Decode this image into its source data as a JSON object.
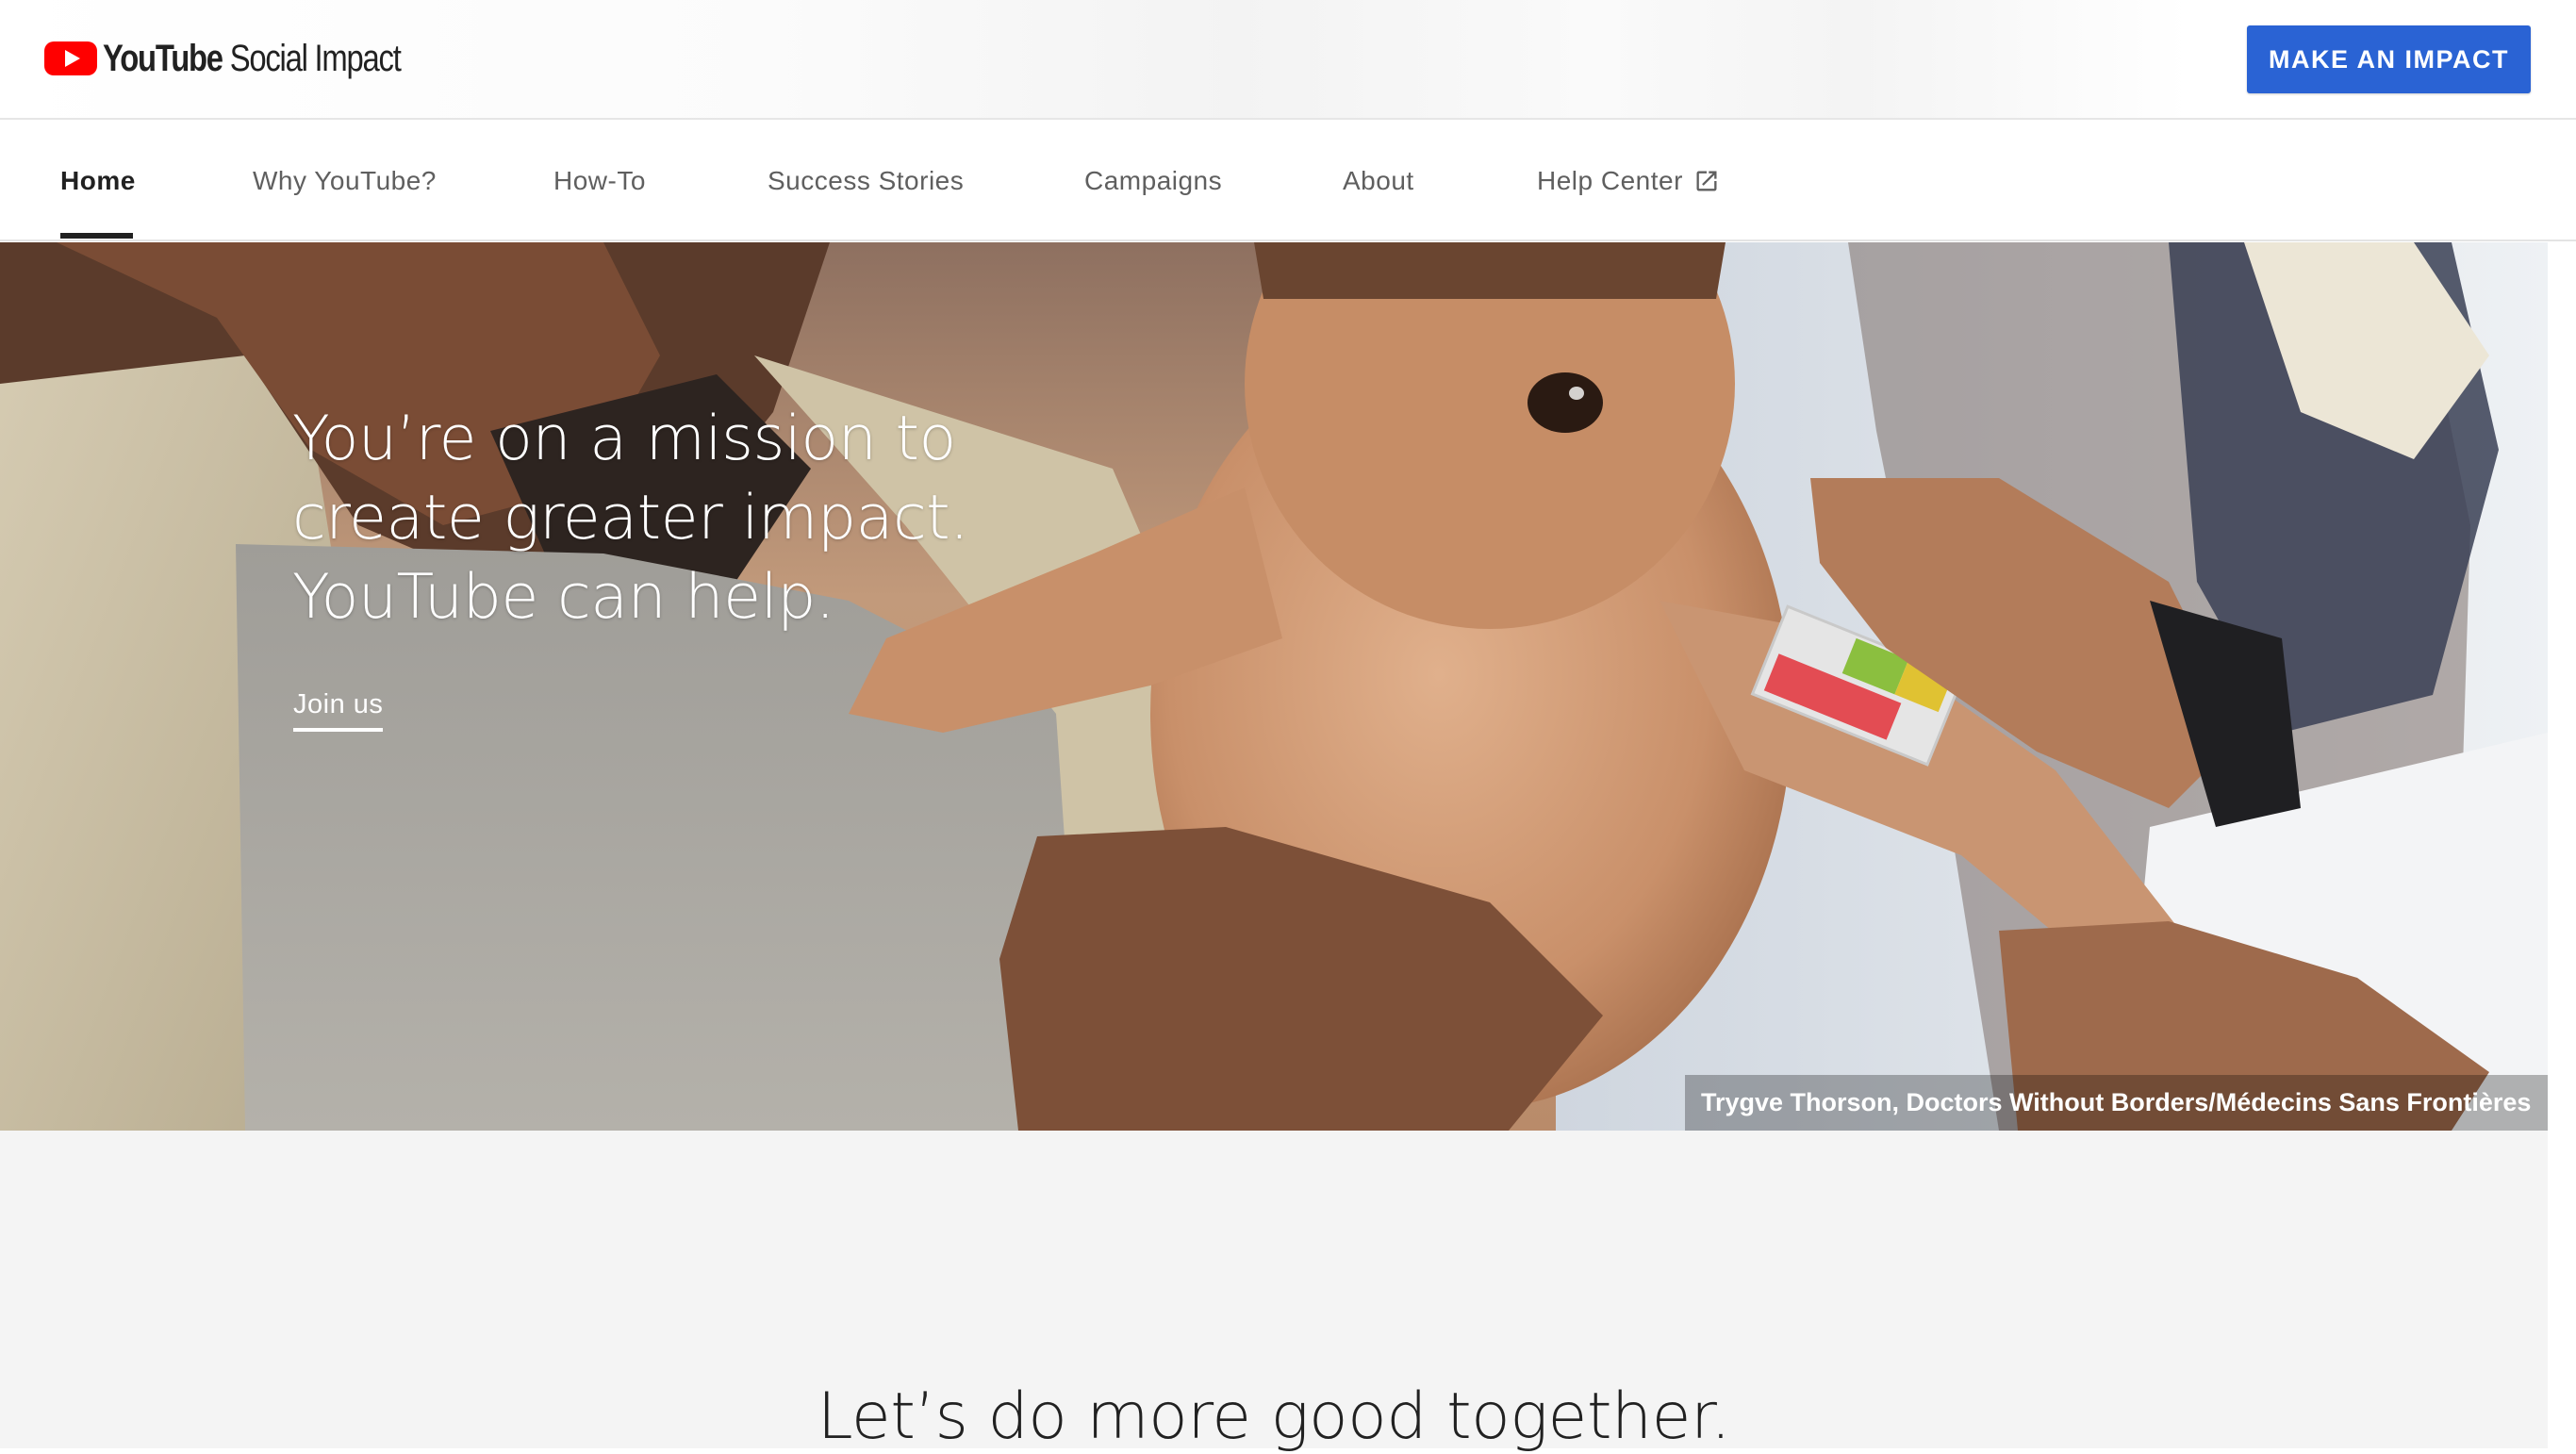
{
  "header": {
    "logo_brand": "YouTube",
    "logo_suffix": "Social Impact",
    "cta_label": "MAKE AN IMPACT",
    "brand_red": "#ff0000",
    "cta_color": "#2a63d4"
  },
  "nav": {
    "items": [
      {
        "label": "Home",
        "active": true
      },
      {
        "label": "Why YouTube?"
      },
      {
        "label": "How-To"
      },
      {
        "label": "Success Stories"
      },
      {
        "label": "Campaigns"
      },
      {
        "label": "About"
      },
      {
        "label": "Help Center",
        "icon": "external-link-icon"
      }
    ]
  },
  "hero": {
    "headline": [
      "You’re on a mission to",
      "create greater impact.",
      "YouTube can help."
    ],
    "link_label": "Join us",
    "photo_credit": "Trygve Thorson, Doctors Without Borders/Médecins Sans Frontières"
  },
  "section": {
    "title": "Let’s do more good together."
  }
}
